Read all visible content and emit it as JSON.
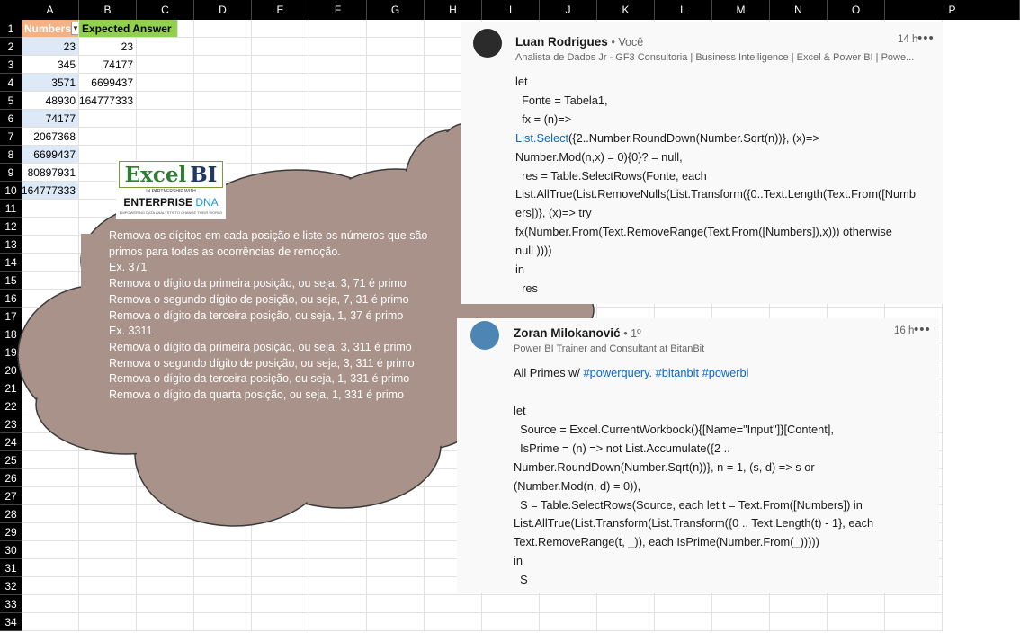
{
  "spreadsheet": {
    "columns": [
      "A",
      "B",
      "C",
      "D",
      "E",
      "F",
      "G",
      "H",
      "I",
      "J",
      "K",
      "L",
      "M",
      "N",
      "O",
      "P"
    ],
    "rows": [
      "1",
      "2",
      "3",
      "4",
      "5",
      "6",
      "7",
      "8",
      "9",
      "10",
      "11",
      "12",
      "13",
      "14",
      "15",
      "16",
      "17",
      "18",
      "19",
      "20",
      "21",
      "22",
      "23",
      "24",
      "25",
      "26",
      "27",
      "28",
      "29",
      "30",
      "31",
      "32",
      "33",
      "34"
    ],
    "header_numbers": "Numbers",
    "header_expected": "Expected Answer",
    "numbers": [
      "23",
      "345",
      "3571",
      "48930",
      "74177",
      "2067368",
      "6699437",
      "80897931",
      "164777333"
    ],
    "expected": [
      "23",
      "74177",
      "6699437",
      "164777333"
    ]
  },
  "logo": {
    "brand_left": "Excel",
    "brand_right": "BI",
    "partnership": "IN PARTNERSHIP WITH",
    "enterprise": "ENTERPRISE",
    "dna": "DNA",
    "tagline": "EMPOWERING DATA ANALYSTS TO CHANGE THEIR WORLD"
  },
  "cloud": {
    "color": "#a89289",
    "lines": [
      "Remova os dígitos em cada posição e liste os números que são",
      "primos para todas as ocorrências de remoção.",
      "Ex. 371",
      "Remova o dígito da primeira posição, ou seja, 3, 71 é primo",
      "Remova o segundo dígito de posição, ou seja, 7, 31 é primo",
      "Remova o dígito da terceira posição, ou seja, 1, 37 é primo",
      "Ex. 3311",
      "Remova o dígito da primeira posição, ou seja, 3, 311 é primo",
      "Remova o segundo dígito de posição, ou seja, 3, 311 é primo",
      "Remova o dígito da terceira posição, ou seja, 1, 331 é primo",
      "Remova o dígito da quarta posição, ou seja, 1, 331 é primo"
    ]
  },
  "post1": {
    "name": "Luan Rodrigues",
    "badge": "• Você",
    "headline": "Analista de Dados Jr - GF3 Consultoria | Business Intelligence | Excel & Power BI | Powe...",
    "time": "14 h",
    "menu": "•••",
    "code_lines": [
      "let",
      "  Fonte = Tabela1,",
      "  fx = (n)=>",
      "",
      "Number.Mod(n,x) = 0){0}? = null,",
      "  res = Table.SelectRows(Fonte, each",
      "List.AllTrue(List.RemoveNulls(List.Transform({0..Text.Length(Text.From([Numb",
      "ers])}, (x)=> try",
      "fx(Number.From(Text.RemoveRange(Text.From([Numbers]),x))) otherwise",
      "null ))))",
      "in",
      "  res"
    ],
    "code_line4_link": "List.Select",
    "code_line4_rest": "({2..Number.RoundDown(Number.Sqrt(n))}, (x)=>"
  },
  "post2": {
    "name": "Zoran Milokanović",
    "badge": "• 1º",
    "headline": "Power BI Trainer and Consultant at BitanBit",
    "time": "16 h",
    "menu": "•••",
    "intro": "All Primes w/ ",
    "hashtags": "#powerquery. #bitanbit #powerbi",
    "code_lines": [
      "let",
      "  Source = Excel.CurrentWorkbook(){[Name=\"Input\"]}[Content],",
      "  IsPrime = (n) => not List.Accumulate({2 ..",
      "Number.RoundDown(Number.Sqrt(n))}, n = 1, (s, d) => s or",
      "(Number.Mod(n, d) = 0)),",
      "  S = Table.SelectRows(Source, each let t = Text.From([Numbers]) in",
      "List.AllTrue(List.Transform(List.Transform({0 .. Text.Length(t) - 1}, each",
      "Text.RemoveRange(t, _)), each IsPrime(Number.From(_)))))",
      "in",
      "  S"
    ]
  }
}
